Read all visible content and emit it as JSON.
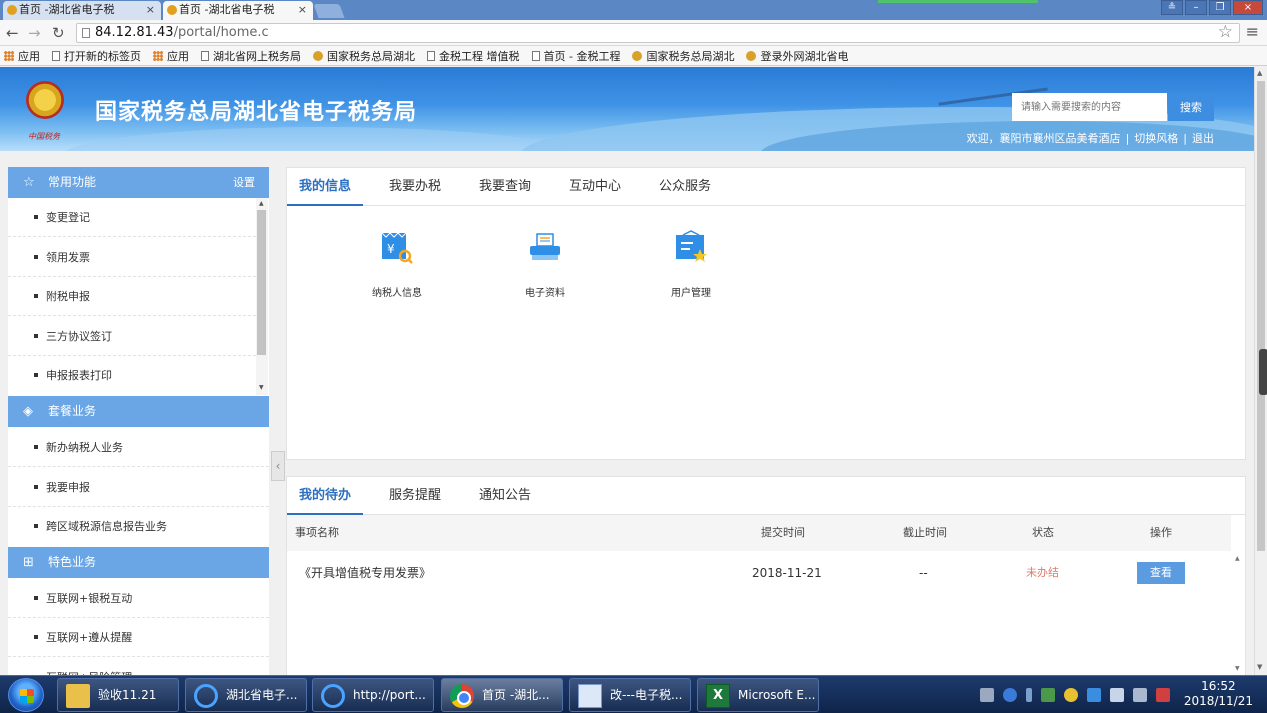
{
  "browser": {
    "tabs": [
      {
        "label": "首页 -湖北省电子税"
      },
      {
        "label": "首页 -湖北省电子税"
      }
    ],
    "address": {
      "host": "84.12.81.43",
      "path": "/portal/home.c"
    },
    "bookmarks": [
      {
        "label": "应用",
        "icon": "apps-icon"
      },
      {
        "label": "打开新的标签页",
        "icon": "page-icon"
      },
      {
        "label": "应用",
        "icon": "apps-icon"
      },
      {
        "label": "湖北省网上税务局",
        "icon": "page-icon"
      },
      {
        "label": "国家税务总局湖北",
        "icon": "emblem-icon"
      },
      {
        "label": "金税工程 增值税",
        "icon": "page-icon"
      },
      {
        "label": "首页 - 金税工程",
        "icon": "page-icon"
      },
      {
        "label": "国家税务总局湖北",
        "icon": "emblem-icon"
      },
      {
        "label": "登录外网湖北省电",
        "icon": "emblem-icon"
      }
    ]
  },
  "site": {
    "title": "国家税务总局湖北省电子税务局",
    "emblem_text": "中国税务",
    "search": {
      "placeholder": "请输入需要搜索的内容",
      "button": "搜索"
    },
    "user": {
      "welcome": "欢迎，襄阳市襄州区品美肴酒店",
      "switch_style": "切换风格",
      "logout": "退出"
    }
  },
  "sidebar": {
    "sections": [
      {
        "title": "常用功能",
        "icon": "star-icon",
        "action": "设置",
        "items": [
          "变更登记",
          "领用发票",
          "附税申报",
          "三方协议签订",
          "申报报表打印"
        ]
      },
      {
        "title": "套餐业务",
        "icon": "layers-icon",
        "items": [
          "新办纳税人业务",
          "我要申报",
          "跨区域税源信息报告业务"
        ]
      },
      {
        "title": "特色业务",
        "icon": "grid-icon",
        "items": [
          "互联网+银税互动",
          "互联网+遵从提醒",
          "互联网+风险管理"
        ]
      }
    ]
  },
  "main": {
    "top_tabs": [
      "我的信息",
      "我要办税",
      "我要查询",
      "互动中心",
      "公众服务"
    ],
    "apps": [
      {
        "label": "纳税人信息",
        "icon": "taxpayer-info-icon"
      },
      {
        "label": "电子资料",
        "icon": "e-document-icon"
      },
      {
        "label": "用户管理",
        "icon": "user-management-icon"
      }
    ],
    "bottom_tabs": [
      "我的待办",
      "服务提醒",
      "通知公告"
    ],
    "todo_table": {
      "columns": [
        "事项名称",
        "提交时间",
        "截止时间",
        "状态",
        "操作"
      ],
      "rows": [
        {
          "name": "《开具增值税专用发票》",
          "submitted": "2018-11-21",
          "deadline": "--",
          "status": "未办结",
          "action": "查看"
        }
      ]
    }
  },
  "taskbar": {
    "items": [
      {
        "label": "验收11.21",
        "icon": "folder-icon"
      },
      {
        "label": "湖北省电子...",
        "icon": "ie-icon"
      },
      {
        "label": "http://port...",
        "icon": "ie-icon"
      },
      {
        "label": "首页 -湖北...",
        "icon": "chrome-icon"
      },
      {
        "label": "改---电子税...",
        "icon": "word-icon"
      },
      {
        "label": "Microsoft E...",
        "icon": "excel-icon"
      }
    ],
    "clock": {
      "time": "16:52",
      "date": "2018/11/21"
    }
  },
  "colors": {
    "header_blue": "#2a7bd6",
    "sidebar_section": "#6aa6e6",
    "active_tab": "#2d6fc0",
    "status_pending": "#e07a6a",
    "view_button": "#5b9be0"
  }
}
